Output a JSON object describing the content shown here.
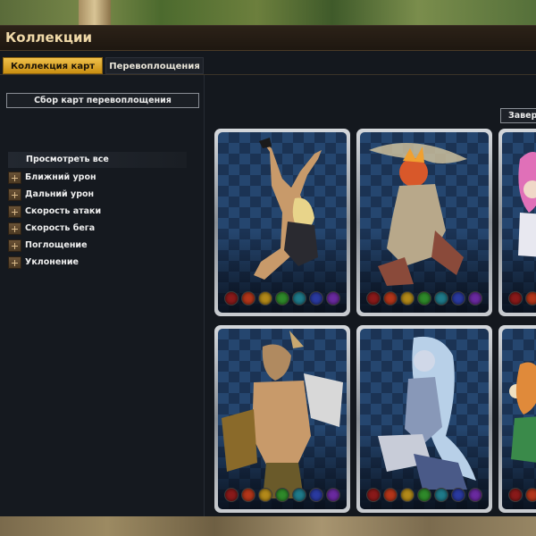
{
  "window": {
    "title": "Коллекции"
  },
  "tabs": [
    {
      "label": "Коллекция карт",
      "active": true
    },
    {
      "label": "Перевоплощения",
      "active": false
    }
  ],
  "sidebar": {
    "collect_button": "Сбор карт перевоплощения",
    "view_all": "Просмотреть все",
    "categories": [
      {
        "label": "Ближний урон"
      },
      {
        "label": "Дальний урон"
      },
      {
        "label": "Скорость атаки"
      },
      {
        "label": "Скорость бега"
      },
      {
        "label": "Поглощение"
      },
      {
        "label": "Уклонение"
      }
    ]
  },
  "main": {
    "complete_button": "Завер"
  },
  "gem_colors": [
    "#8a1a1a",
    "#b3361a",
    "#b38a1a",
    "#2f8a2a",
    "#1f7a8a",
    "#2a3aa0",
    "#6a2aa0"
  ],
  "cards": [
    {
      "figure": "dancer-blonde-icon"
    },
    {
      "figure": "fire-mask-warrior-icon"
    },
    {
      "figure": "pink-hair-character-icon"
    },
    {
      "figure": "golden-armor-warrior-icon"
    },
    {
      "figure": "ice-elf-maiden-icon"
    },
    {
      "figure": "orange-hair-character-icon"
    }
  ],
  "colors": {
    "accent": "#e0a52a",
    "title": "#f0d9a8",
    "card_bg": "#25466f"
  }
}
